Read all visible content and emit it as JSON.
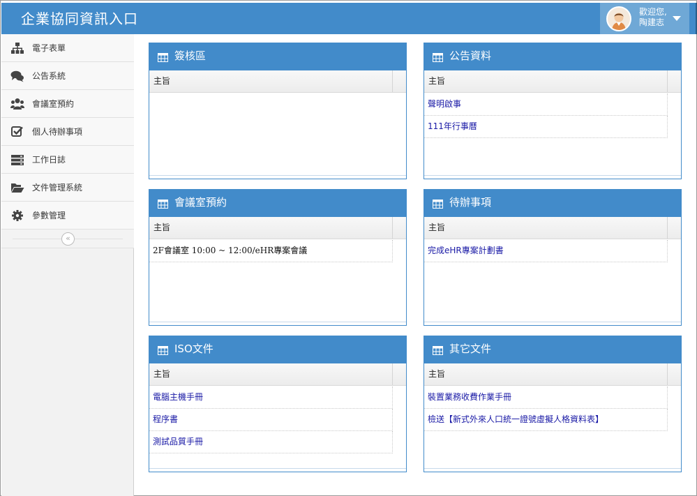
{
  "header": {
    "title": "企業協同資訊入口",
    "welcome_line1": "歡迎您,",
    "welcome_line2": "陶建志",
    "avatar_icon": "user-avatar-icon",
    "dropdown_icon": "caret-down-icon",
    "bar_color": "#428bca"
  },
  "sidebar": {
    "items": [
      {
        "label": "電子表單",
        "icon": "sitemap-icon"
      },
      {
        "label": "公告系統",
        "icon": "comments-icon"
      },
      {
        "label": "會議室預約",
        "icon": "users-icon"
      },
      {
        "label": "個人待辦事項",
        "icon": "check-square-icon"
      },
      {
        "label": "工作日誌",
        "icon": "server-icon"
      },
      {
        "label": "文件管理系統",
        "icon": "folder-open-icon"
      },
      {
        "label": "參數管理",
        "icon": "gear-icon"
      }
    ],
    "collapse_glyph": "«"
  },
  "panels": {
    "signoff": {
      "title": "簽核區",
      "column": "主旨",
      "rows": []
    },
    "announcements": {
      "title": "公告資料",
      "column": "主旨",
      "rows": [
        "聲明啟事",
        "111年行事曆"
      ]
    },
    "meeting": {
      "title": "會議室預約",
      "column": "主旨",
      "rows": [
        "2F會議室 10:00 ~ 12:00/eHR專案會議"
      ]
    },
    "todo": {
      "title": "待辦事項",
      "column": "主旨",
      "rows": [
        "完成eHR專案計劃書"
      ]
    },
    "iso": {
      "title": "ISO文件",
      "column": "主旨",
      "rows": [
        "電腦主機手冊",
        "程序書",
        "測試品質手冊"
      ]
    },
    "other": {
      "title": "其它文件",
      "column": "主旨",
      "rows": [
        "裝置業務收費作業手冊",
        "檢送【新式外來人口統一證號虛擬人格資料表】"
      ]
    }
  }
}
